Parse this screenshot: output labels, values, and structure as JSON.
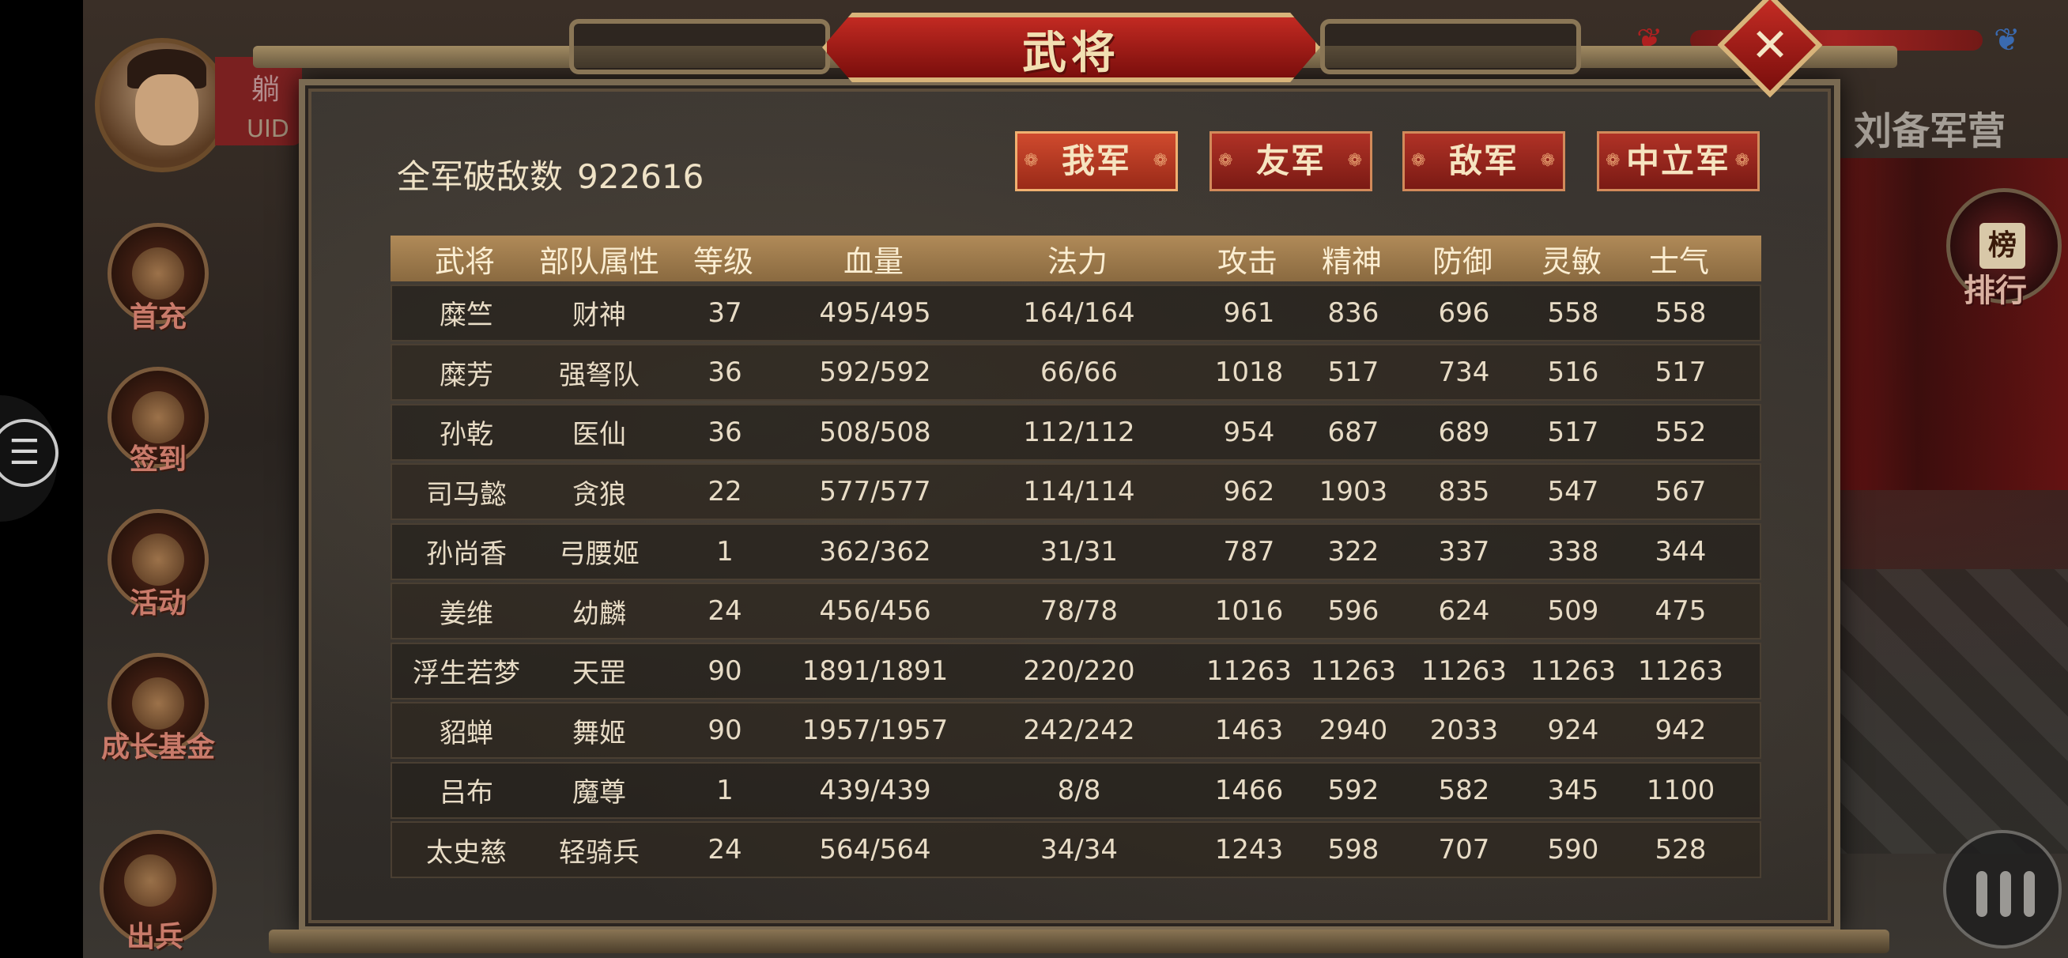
{
  "dialog": {
    "title": "武将"
  },
  "summary": {
    "kill_label": "全军破敌数",
    "kill_value": "922616"
  },
  "factions": [
    "我军",
    "友军",
    "敌军",
    "中立军"
  ],
  "table": {
    "headers": [
      "武将",
      "部队属性",
      "等级",
      "血量",
      "法力",
      "攻击",
      "精神",
      "防御",
      "灵敏",
      "士气"
    ],
    "rows": [
      [
        "糜竺",
        "财神",
        "37",
        "495/495",
        "164/164",
        "961",
        "836",
        "696",
        "558",
        "558"
      ],
      [
        "糜芳",
        "强弩队",
        "36",
        "592/592",
        "66/66",
        "1018",
        "517",
        "734",
        "516",
        "517"
      ],
      [
        "孙乾",
        "医仙",
        "36",
        "508/508",
        "112/112",
        "954",
        "687",
        "689",
        "517",
        "552"
      ],
      [
        "司马懿",
        "贪狼",
        "22",
        "577/577",
        "114/114",
        "962",
        "1903",
        "835",
        "547",
        "567"
      ],
      [
        "孙尚香",
        "弓腰姬",
        "1",
        "362/362",
        "31/31",
        "787",
        "322",
        "337",
        "338",
        "344"
      ],
      [
        "姜维",
        "幼麟",
        "24",
        "456/456",
        "78/78",
        "1016",
        "596",
        "624",
        "509",
        "475"
      ],
      [
        "浮生若梦",
        "天罡",
        "90",
        "1891/1891",
        "220/220",
        "11263",
        "11263",
        "11263",
        "11263",
        "11263"
      ],
      [
        "貂蝉",
        "舞姬",
        "90",
        "1957/1957",
        "242/242",
        "1463",
        "2940",
        "2033",
        "924",
        "942"
      ],
      [
        "吕布",
        "魔尊",
        "1",
        "439/439",
        "8/8",
        "1466",
        "592",
        "582",
        "345",
        "1100"
      ],
      [
        "太史慈",
        "轻骑兵",
        "24",
        "564/564",
        "34/34",
        "1243",
        "598",
        "707",
        "590",
        "528"
      ]
    ]
  },
  "background": {
    "player_name": "躺",
    "uid_label": "UID",
    "camp_label": "刘备军营",
    "rank_label": "排行",
    "rank_icon_text": "榜",
    "side_buttons": [
      "首充",
      "签到",
      "活动",
      "成长基金",
      "出兵"
    ]
  },
  "icons": {
    "close": "close-icon",
    "menu": "menu-icon"
  }
}
